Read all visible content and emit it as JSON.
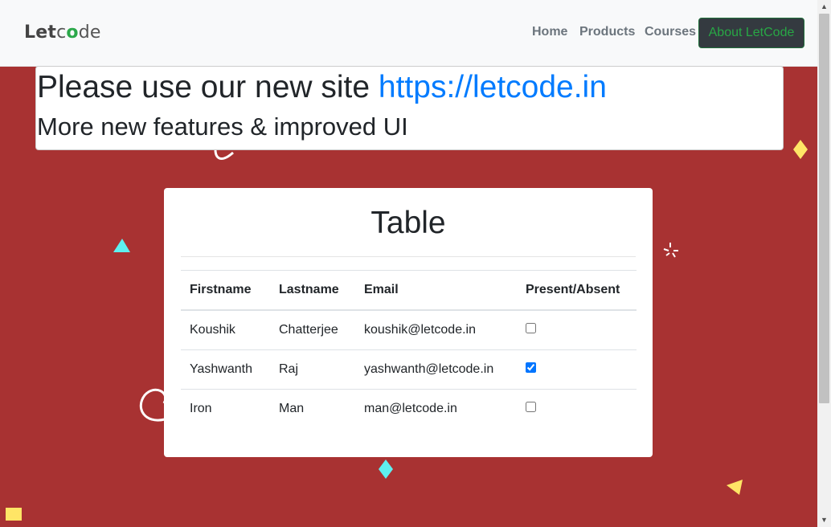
{
  "navbar": {
    "logo_text_let": "Let",
    "logo_text_c": "c",
    "logo_text_o": "o",
    "logo_text_de": "de",
    "links": [
      "Home",
      "Products",
      "Courses"
    ],
    "about_label": "About LetCode"
  },
  "banner": {
    "line1_prefix": "Please use our new site ",
    "line1_link": "https://letcode.in",
    "line2": "More new features & improved UI"
  },
  "card": {
    "title": "Table",
    "headers": [
      "Firstname",
      "Lastname",
      "Email",
      "Present/Absent"
    ],
    "rows": [
      {
        "first": "Koushik",
        "last": "Chatterjee",
        "email": "koushik@letcode.in",
        "present": false
      },
      {
        "first": "Yashwanth",
        "last": "Raj",
        "email": "yashwanth@letcode.in",
        "present": true
      },
      {
        "first": "Iron",
        "last": "Man",
        "email": "man@letcode.in",
        "present": false
      }
    ]
  },
  "colors": {
    "background": "#a83232",
    "link": "#007bff",
    "about_text": "#28a745"
  }
}
